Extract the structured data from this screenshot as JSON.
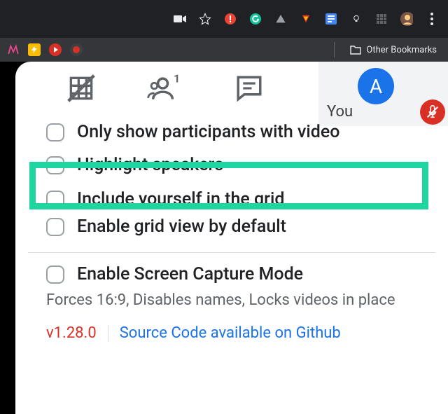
{
  "chrome": {
    "other_bookmarks": "Other Bookmarks"
  },
  "you_tile": {
    "label": "You",
    "avatar_initial": "A"
  },
  "options": {
    "only_video": "Only show participants with video",
    "highlight_speakers": "Highlight speakers",
    "include_yourself": "Include yourself in the grid",
    "enable_default": "Enable grid view by default",
    "screen_capture": "Enable Screen Capture Mode",
    "screen_capture_desc": "Forces 16:9, Disables names, Locks videos in place"
  },
  "footer": {
    "version": "v1.28.0",
    "source": "Source Code available on Github"
  }
}
